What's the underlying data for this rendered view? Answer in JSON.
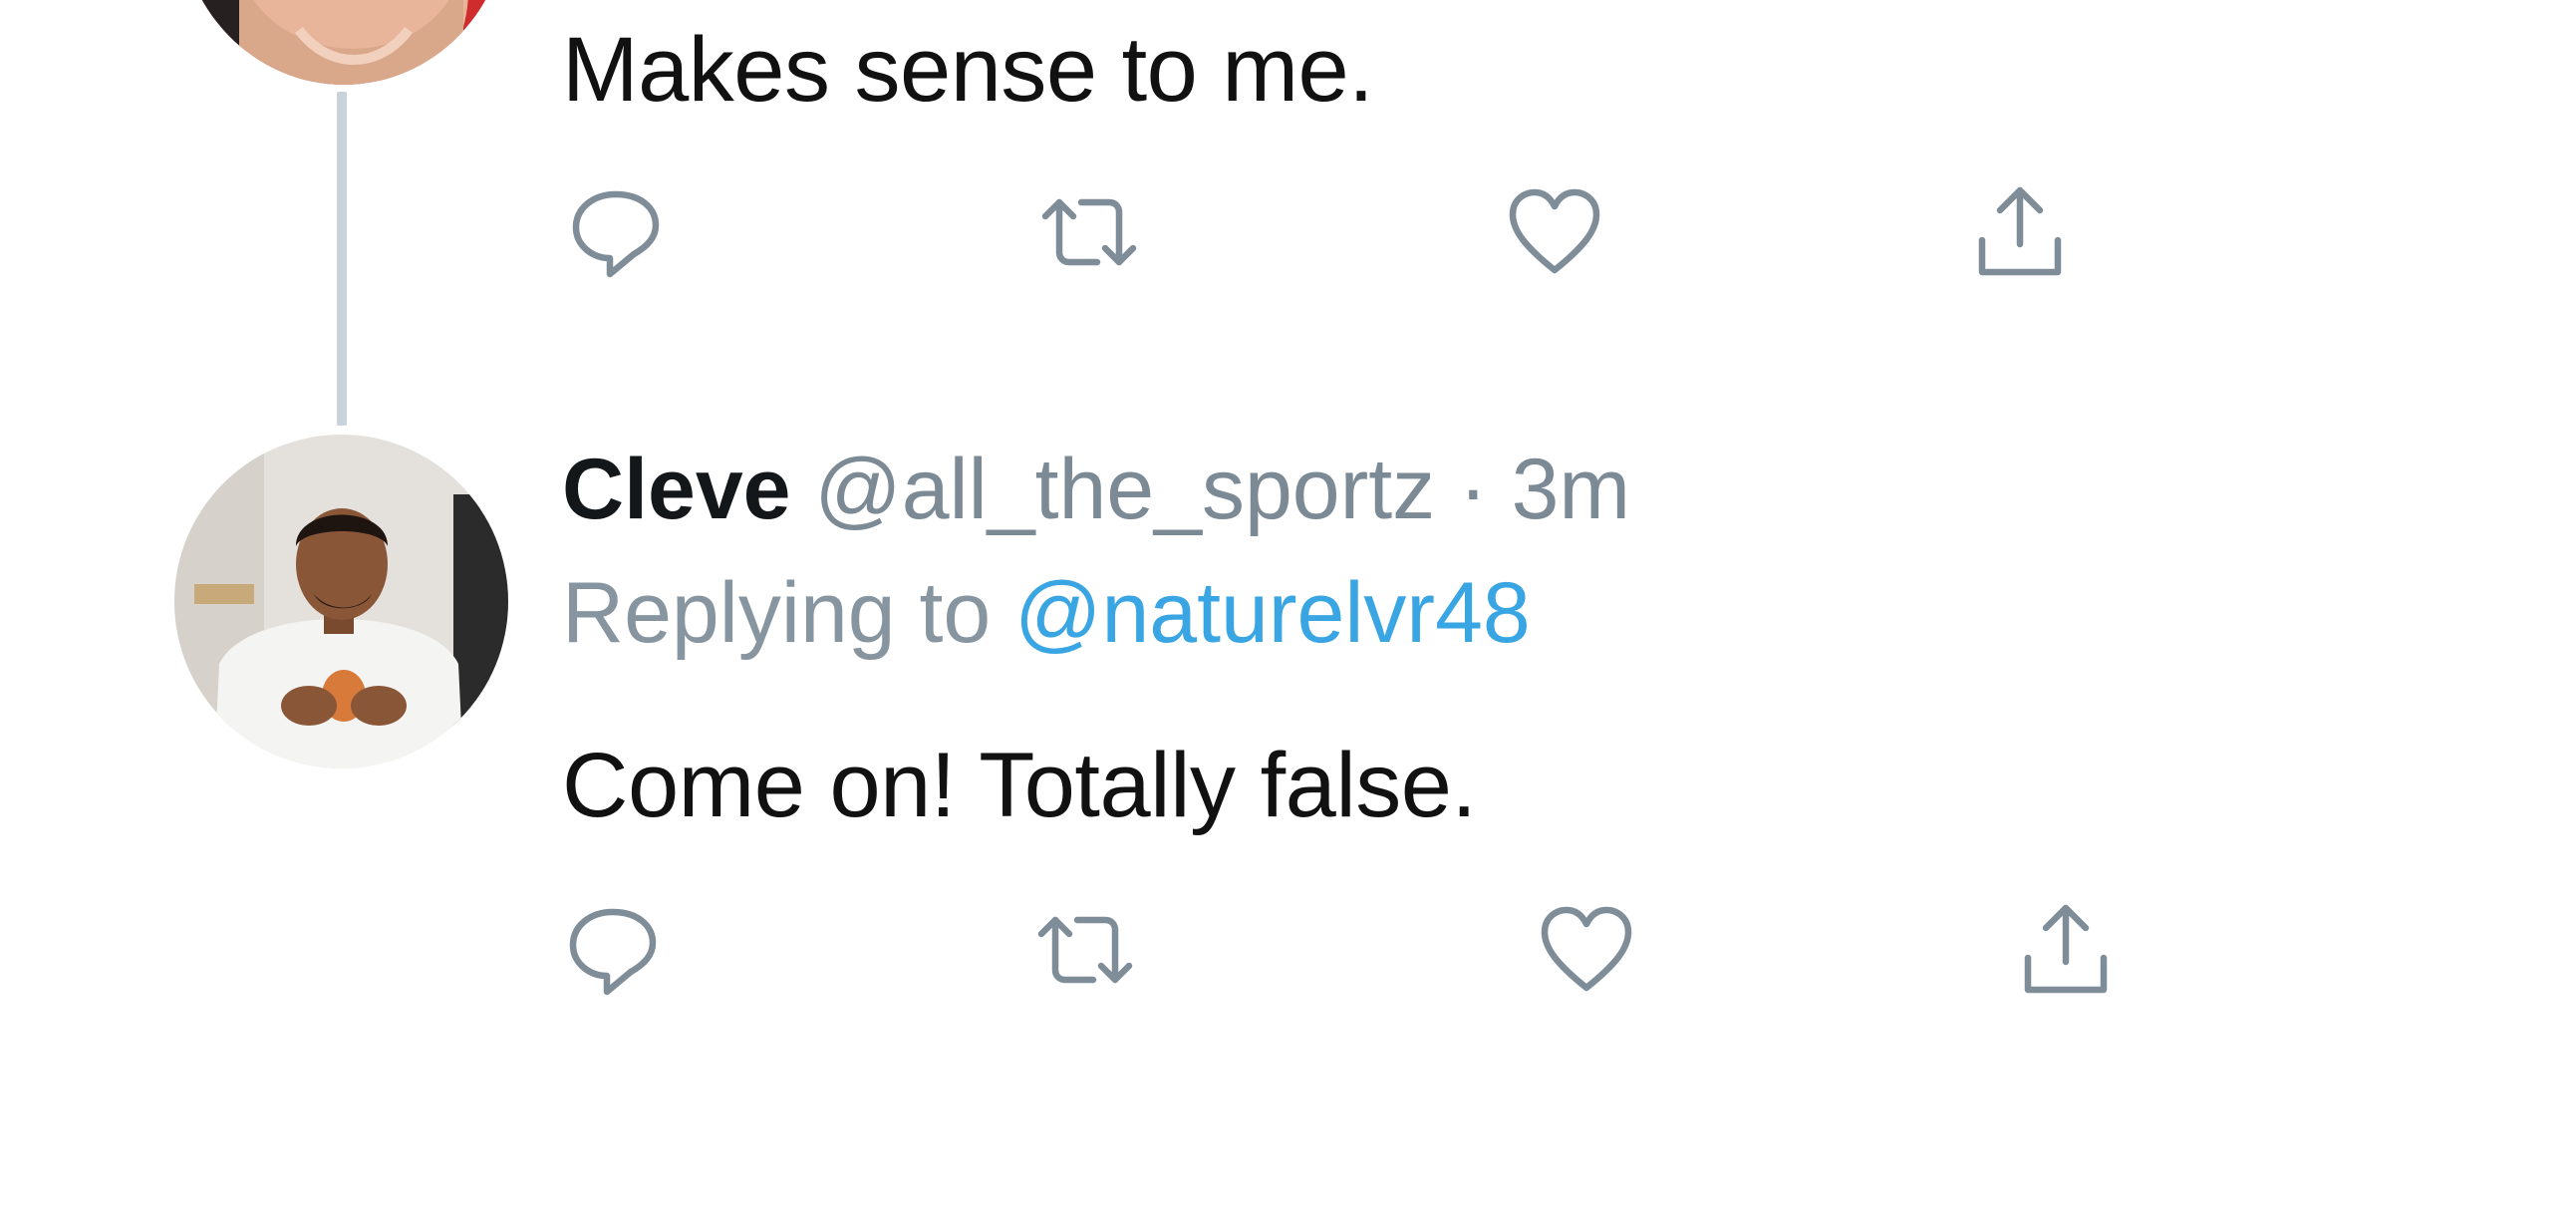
{
  "tweets": [
    {
      "text": "Makes sense to me.",
      "actions": {
        "reply_icon": "reply-bubble-icon",
        "retweet_icon": "retweet-icon",
        "like_icon": "heart-icon",
        "share_icon": "share-icon"
      }
    },
    {
      "name": "Cleve",
      "handle_and_time": "@all_the_sportz · 3m",
      "replying_prefix": "Replying to",
      "replying_to": "@naturelvr48",
      "text": "Come on! Totally false.",
      "actions": {
        "reply_icon": "reply-bubble-icon",
        "retweet_icon": "retweet-icon",
        "like_icon": "heart-icon",
        "share_icon": "share-icon"
      }
    }
  ],
  "colors": {
    "icon_gray": "#7f8d99",
    "mention_blue": "#3aa5e3",
    "thread_line": "#c9d3dc",
    "text_dark": "#14171a"
  }
}
